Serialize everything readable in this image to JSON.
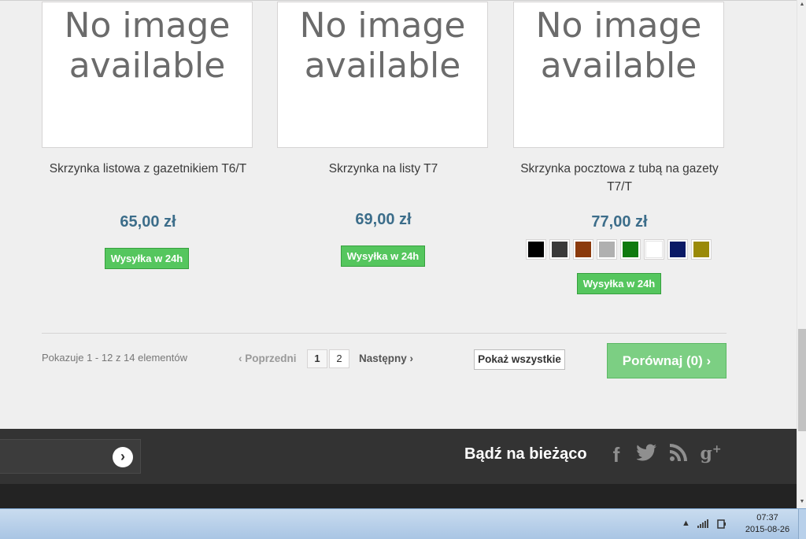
{
  "products": [
    {
      "image_text_line1": "No image",
      "image_text_line2": "available",
      "name": "Skrzynka listowa z gazetnikiem T6/T",
      "price": "65,00 zł",
      "badge": "Wysyłka w 24h"
    },
    {
      "image_text_line1": "No image",
      "image_text_line2": "available",
      "name": "Skrzynka na listy T7",
      "price": "69,00 zł",
      "badge": "Wysyłka w 24h"
    },
    {
      "image_text_line1": "No image",
      "image_text_line2": "available",
      "name": "Skrzynka pocztowa z tubą na gazety T7/T",
      "price": "77,00 zł",
      "badge": "Wysyłka w 24h",
      "color_swatches": [
        "#000000",
        "#3a3a3a",
        "#8b3a0c",
        "#b0b0b0",
        "#0f7a0f",
        "#ffffff",
        "#0b1a66",
        "#9a8a08"
      ]
    }
  ],
  "pagination": {
    "count_text": "Pokazuje 1 - 12 z 14 elementów",
    "prev_label": "Poprzedni",
    "pages": [
      "1",
      "2"
    ],
    "next_label": "Następny",
    "show_all_label": "Pokaż wszystkie",
    "compare_label": "Porównaj (0)"
  },
  "footer": {
    "follow_title": "Bądź na bieżąco",
    "social_icons": [
      "facebook-icon",
      "twitter-icon",
      "rss-icon",
      "google-plus-icon"
    ]
  },
  "taskbar": {
    "time": "07:37",
    "date": "2015-08-26"
  },
  "colors": {
    "price": "#3c6d8a",
    "badge": "#55c65e",
    "compare": "#7ccf83",
    "footer": "#333333"
  }
}
